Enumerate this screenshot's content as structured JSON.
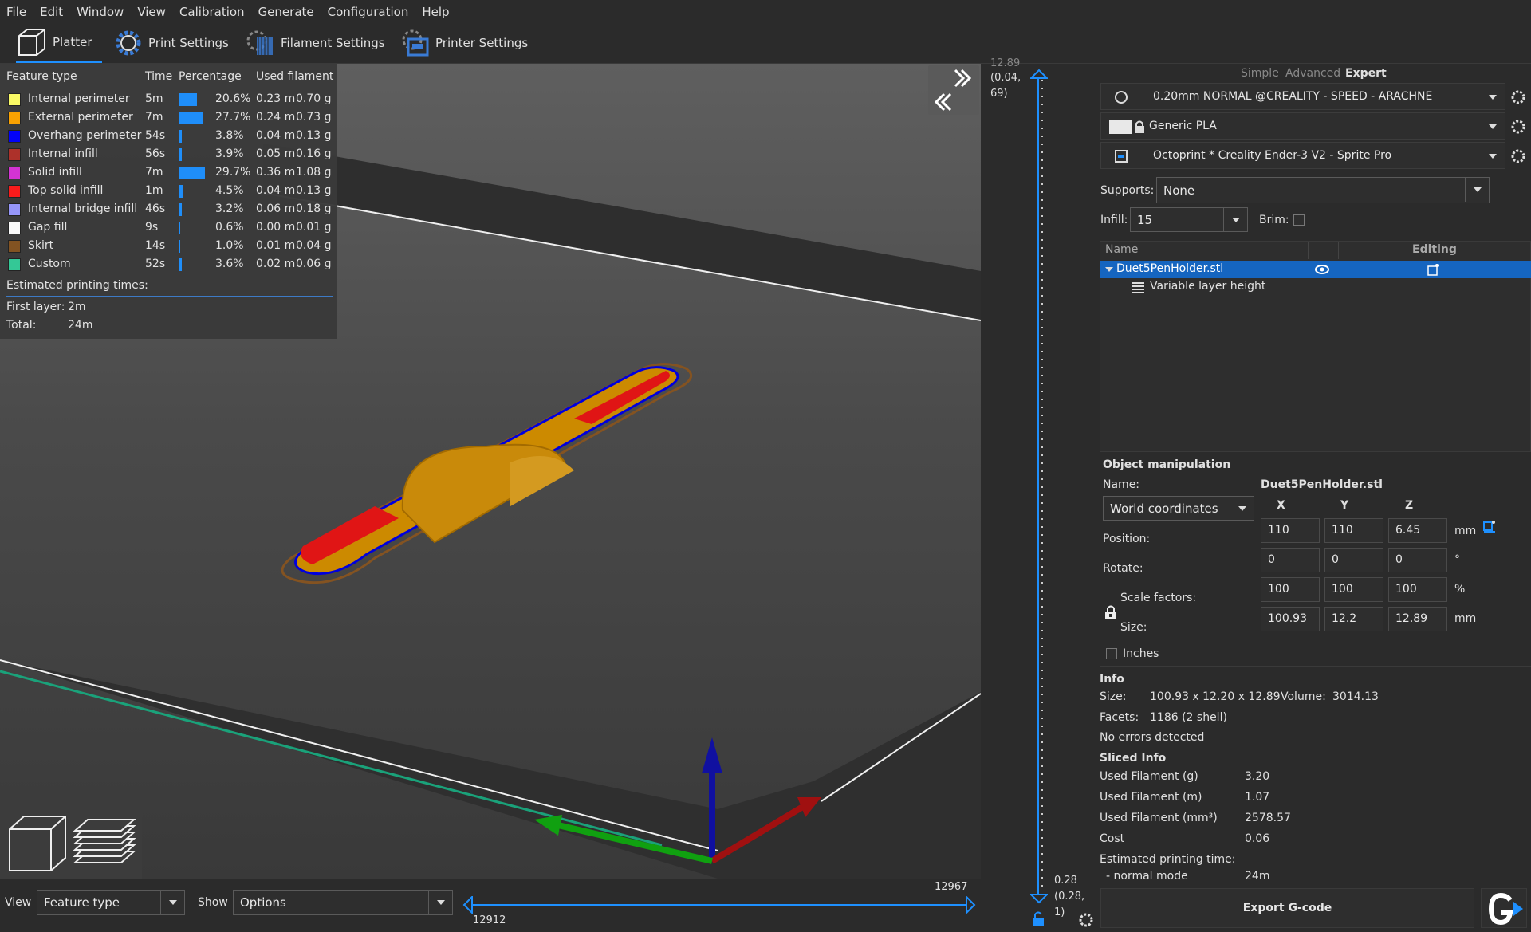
{
  "menu": [
    "File",
    "Edit",
    "Window",
    "View",
    "Calibration",
    "Generate",
    "Configuration",
    "Help"
  ],
  "tabs": {
    "platter": "Platter",
    "print": "Print Settings",
    "filament": "Filament Settings",
    "printer": "Printer Settings"
  },
  "legend": {
    "headers": {
      "feature": "Feature type",
      "time": "Time",
      "percentage": "Percentage",
      "used": "Used filament"
    },
    "rows": [
      {
        "name": "Internal perimeter",
        "time": "5m",
        "pct": "20.6%",
        "len": "0.23 m",
        "g": "0.70 g",
        "color": "#ffff66",
        "share": 0.206
      },
      {
        "name": "External perimeter",
        "time": "7m",
        "pct": "27.7%",
        "len": "0.24 m",
        "g": "0.73 g",
        "color": "#ffa500",
        "share": 0.277
      },
      {
        "name": "Overhang perimeter",
        "time": "54s",
        "pct": "3.8%",
        "len": "0.04 m",
        "g": "0.13 g",
        "color": "#0000ff",
        "share": 0.038
      },
      {
        "name": "Internal infill",
        "time": "56s",
        "pct": "3.9%",
        "len": "0.05 m",
        "g": "0.16 g",
        "color": "#b03029",
        "share": 0.039
      },
      {
        "name": "Solid infill",
        "time": "7m",
        "pct": "29.7%",
        "len": "0.36 m",
        "g": "1.08 g",
        "color": "#d732d7",
        "share": 0.297
      },
      {
        "name": "Top solid infill",
        "time": "1m",
        "pct": "4.5%",
        "len": "0.04 m",
        "g": "0.13 g",
        "color": "#ff1a1a",
        "share": 0.045
      },
      {
        "name": "Internal bridge infill",
        "time": "46s",
        "pct": "3.2%",
        "len": "0.06 m",
        "g": "0.18 g",
        "color": "#9999ff",
        "share": 0.032
      },
      {
        "name": "Gap fill",
        "time": "9s",
        "pct": "0.6%",
        "len": "0.00 m",
        "g": "0.01 g",
        "color": "#ffffff",
        "share": 0.006
      },
      {
        "name": "Skirt",
        "time": "14s",
        "pct": "1.0%",
        "len": "0.01 m",
        "g": "0.04 g",
        "color": "#845321",
        "share": 0.01
      },
      {
        "name": "Custom",
        "time": "52s",
        "pct": "3.6%",
        "len": "0.02 m",
        "g": "0.06 g",
        "color": "#33cc99",
        "share": 0.036
      }
    ],
    "estimated_label": "Estimated printing times:",
    "first_layer_label": "First layer:",
    "first_layer": "2m",
    "total_label": "Total:",
    "total": "24m"
  },
  "bottom": {
    "view_label": "View",
    "view_value": "Feature type",
    "show_label": "Show",
    "show_value": "Options",
    "slider_right": "12967",
    "slider_left": "12912"
  },
  "vslider": {
    "top_value": "12.89",
    "top_coord": "(0.04,",
    "top_coord2": "69)",
    "bottom_value": "0.28",
    "bottom_coord": "(0.28,",
    "bottom_coord2": "1)"
  },
  "mode": {
    "simple": "Simple",
    "advanced": "Advanced",
    "expert": "Expert"
  },
  "presets": {
    "print": "0.20mm NORMAL @CREALITY - SPEED - ARACHNE",
    "filament": "Generic PLA",
    "printer": "Octoprint * Creality Ender-3 V2 - Sprite Pro"
  },
  "supports": {
    "label": "Supports:",
    "value": "None"
  },
  "infill": {
    "label": "Infill:",
    "value": "15"
  },
  "brim": {
    "label": "Brim:"
  },
  "objlist": {
    "col_name": "Name",
    "col_editing": "Editing",
    "object": "Duet5PenHolder.stl",
    "child": "Variable layer height"
  },
  "manip": {
    "title": "Object manipulation",
    "name_label": "Name:",
    "name_value": "Duet5PenHolder.stl",
    "coord": "World coordinates",
    "x": "X",
    "y": "Y",
    "z": "Z",
    "position_label": "Position:",
    "position": [
      "110",
      "110",
      "6.45"
    ],
    "position_unit": "mm",
    "rotate_label": "Rotate:",
    "rotate": [
      "0",
      "0",
      "0"
    ],
    "rotate_unit": "°",
    "scale_label": "Scale factors:",
    "scale": [
      "100",
      "100",
      "100"
    ],
    "scale_unit": "%",
    "size_label": "Size:",
    "size": [
      "100.93",
      "12.2",
      "12.89"
    ],
    "size_unit": "mm",
    "inches_label": "Inches"
  },
  "info": {
    "title": "Info",
    "size_label": "Size:",
    "size": "100.93 x 12.20 x 12.89",
    "volume_label": "Volume:",
    "volume": "3014.13",
    "facets_label": "Facets:",
    "facets": "1186 (2 shell)",
    "errors": "No errors detected"
  },
  "sliced": {
    "title": "Sliced Info",
    "g_label": "Used Filament (g)",
    "g": "3.20",
    "m_label": "Used Filament (m)",
    "m": "1.07",
    "mm3_label": "Used Filament (mm³)",
    "mm3": "2578.57",
    "cost_label": "Cost",
    "cost": "0.06",
    "est_label": "Estimated printing time:",
    "normal_label": "- normal mode",
    "normal": "24m"
  },
  "export": "Export G-code",
  "colors": {
    "accent": "#1e90ff",
    "selected_row": "#1565c0"
  }
}
